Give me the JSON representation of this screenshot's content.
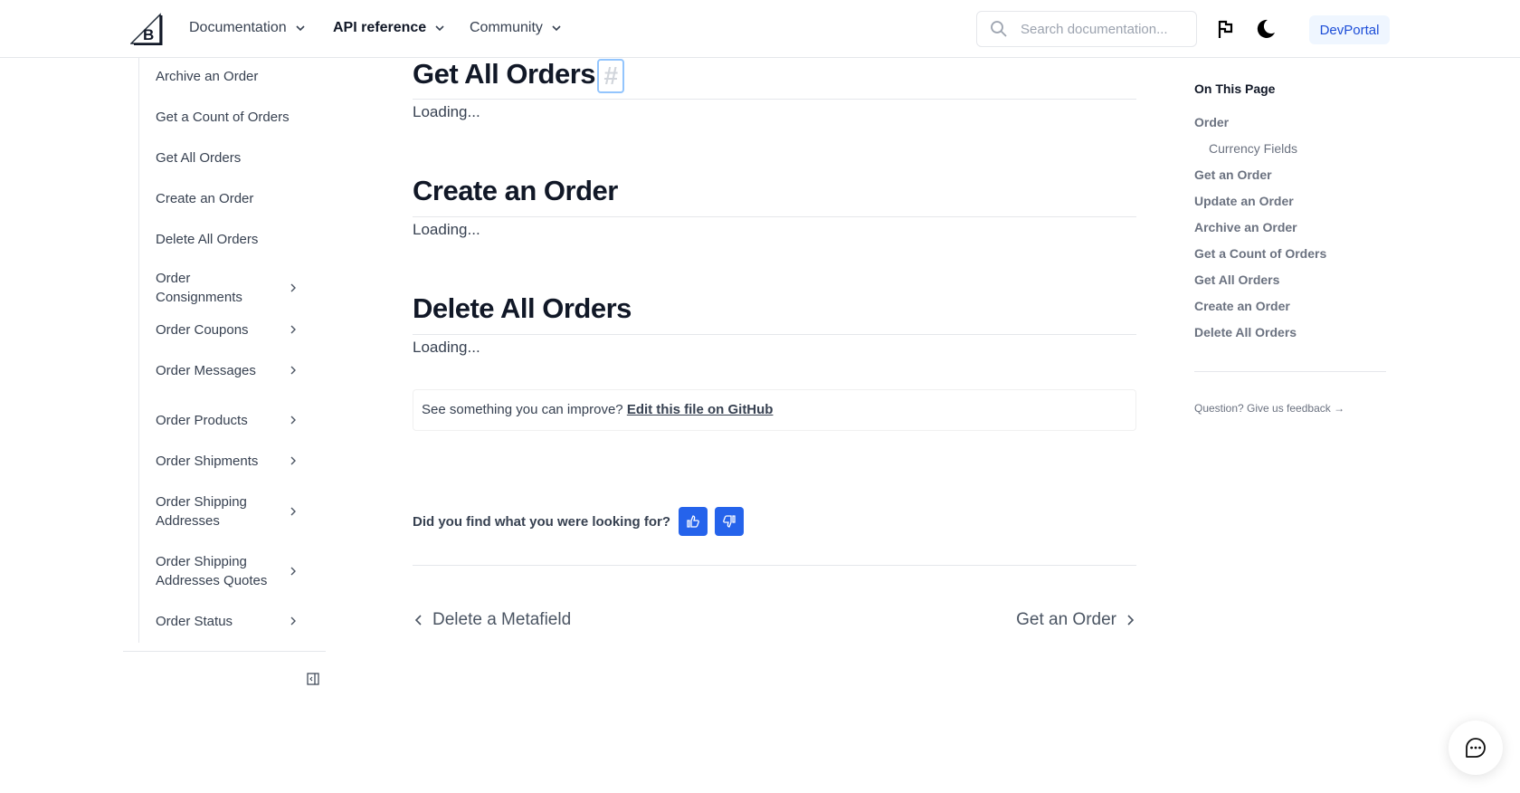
{
  "header": {
    "logo": "bigcommerce-logo",
    "nav": [
      {
        "label": "Documentation",
        "active": false
      },
      {
        "label": "API reference",
        "active": true
      },
      {
        "label": "Community",
        "active": false
      }
    ],
    "search_placeholder": "Search documentation...",
    "search_value": "",
    "devportal_label": "DevPortal"
  },
  "sidebar": {
    "items": [
      {
        "label": "Archive an Order",
        "expandable": false
      },
      {
        "label": "Get a Count of Orders",
        "expandable": false
      },
      {
        "label": "Get All Orders",
        "expandable": false
      },
      {
        "label": "Create an Order",
        "expandable": false
      },
      {
        "label": "Delete All Orders",
        "expandable": false
      },
      {
        "label": "Order Consignments",
        "expandable": true
      },
      {
        "label": "Order Coupons",
        "expandable": true
      },
      {
        "label": "Order Messages",
        "expandable": true
      },
      {
        "label": "Order Products",
        "expandable": true
      },
      {
        "label": "Order Shipments",
        "expandable": true
      },
      {
        "label": "Order Shipping Addresses",
        "expandable": true
      },
      {
        "label": "Order Shipping Addresses Quotes",
        "expandable": true
      },
      {
        "label": "Order Status",
        "expandable": true
      }
    ]
  },
  "main": {
    "sections": [
      {
        "title": "Get All Orders",
        "anchor": "#",
        "body": "Loading..."
      },
      {
        "title": "Create an Order",
        "body": "Loading..."
      },
      {
        "title": "Delete All Orders",
        "body": "Loading..."
      }
    ],
    "edit_prompt": "See something you can improve?",
    "edit_link": "Edit this file on GitHub",
    "feedback_question": "Did you find what you were looking for?",
    "prev_link": "Delete a Metafield",
    "next_link": "Get an Order"
  },
  "toc": {
    "title": "On This Page",
    "items": [
      {
        "label": "Order",
        "sub": false
      },
      {
        "label": "Currency Fields",
        "sub": true
      },
      {
        "label": "Get an Order",
        "sub": false
      },
      {
        "label": "Update an Order",
        "sub": false
      },
      {
        "label": "Archive an Order",
        "sub": false
      },
      {
        "label": "Get a Count of Orders",
        "sub": false
      },
      {
        "label": "Get All Orders",
        "sub": false
      },
      {
        "label": "Create an Order",
        "sub": false
      },
      {
        "label": "Delete All Orders",
        "sub": false
      }
    ],
    "feedback_link": "Question? Give us feedback →"
  },
  "colors": {
    "accent": "#2563eb",
    "devportal_bg": "#eff6ff",
    "devportal_text": "#1d4ed8"
  }
}
